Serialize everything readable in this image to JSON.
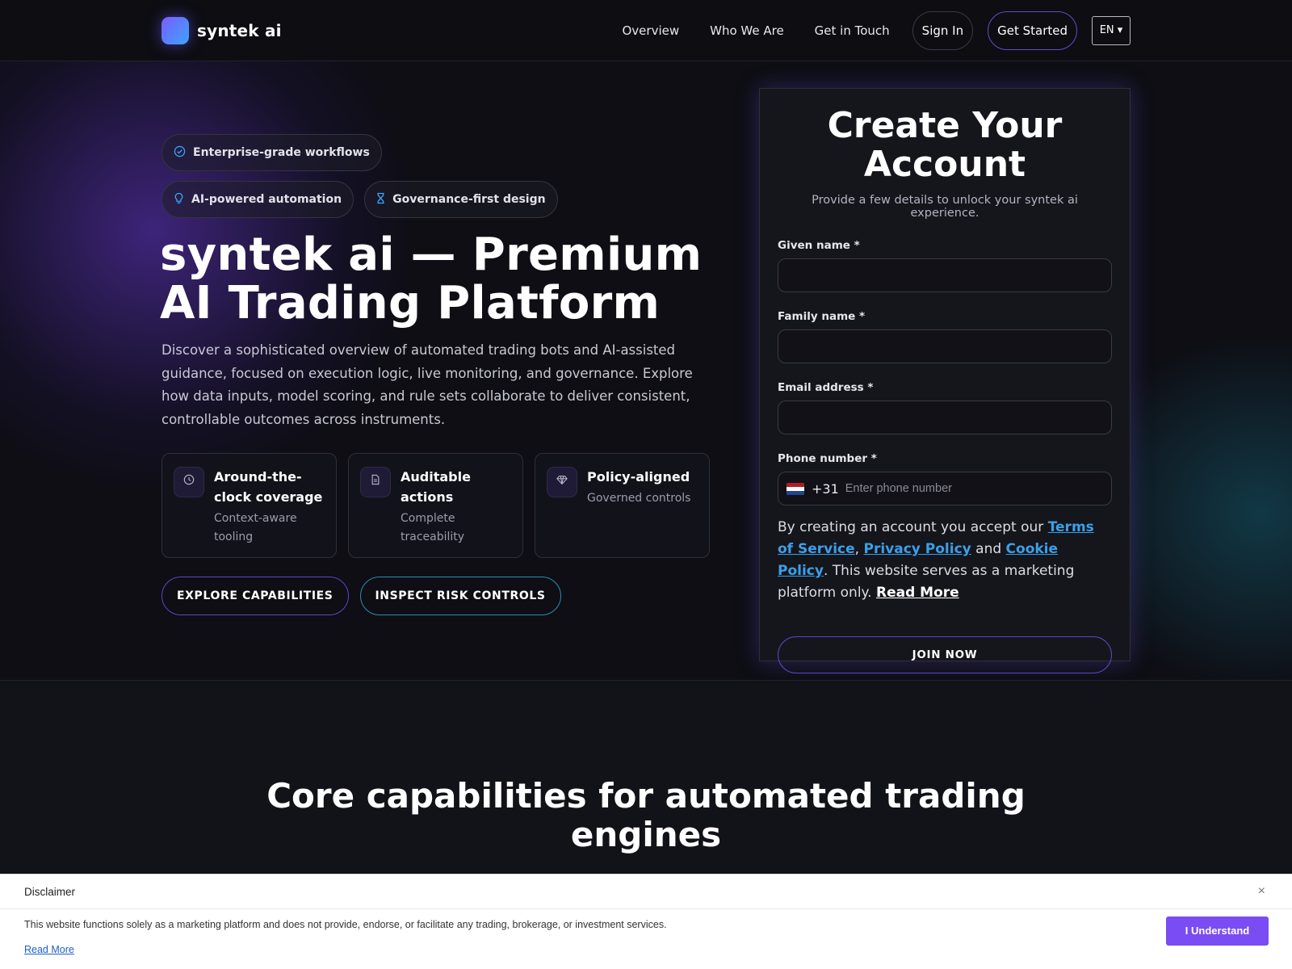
{
  "header": {
    "brand": "syntek ai",
    "nav": [
      "Overview",
      "Who We Are",
      "Get in Touch"
    ],
    "sign_in": "Sign In",
    "get_started": "Get Started",
    "language": "EN ▾"
  },
  "hero": {
    "chips": [
      {
        "icon": "check-circle-icon",
        "label": "Enterprise-grade workflows"
      },
      {
        "icon": "lightbulb-icon",
        "label": "AI-powered automation"
      },
      {
        "icon": "hourglass-icon",
        "label": "Governance-first design"
      }
    ],
    "title": "syntek ai — Premium AI Trading Platform",
    "description": "Discover a sophisticated overview of automated trading bots and AI-assisted guidance, focused on execution logic, live monitoring, and governance. Explore how data inputs, model scoring, and rule sets collaborate to deliver consistent, controllable outcomes across instruments.",
    "features": [
      {
        "icon": "clock-icon",
        "title": "Around-the-clock coverage",
        "subtitle": "Context-aware tooling"
      },
      {
        "icon": "document-icon",
        "title": "Auditable actions",
        "subtitle": "Complete traceability"
      },
      {
        "icon": "diamond-icon",
        "title": "Policy-aligned",
        "subtitle": "Governed controls"
      }
    ],
    "cta_primary": "EXPLORE CAPABILITIES",
    "cta_secondary": "INSPECT RISK CONTROLS"
  },
  "signup": {
    "title": "Create Your Account",
    "subtitle": "Provide a few details to unlock your syntek ai experience.",
    "given_name_label": "Given name *",
    "family_name_label": "Family name *",
    "email_label": "Email address *",
    "phone_label": "Phone number *",
    "dial_code": "+31",
    "phone_placeholder": "Enter phone number",
    "terms_prefix": "By creating an account you accept our ",
    "terms_link": "Terms of Service",
    "comma": ", ",
    "privacy_link": "Privacy Policy",
    "and": " and ",
    "cookie_link": "Cookie Policy",
    "terms_suffix": ". This website serves as a marketing platform only. ",
    "read_more": "Read More",
    "submit": "JOIN NOW"
  },
  "capabilities": {
    "title": "Core capabilities for automated trading engines"
  },
  "disclaimer": {
    "title": "Disclaimer",
    "close": "×",
    "text": "This website functions solely as a marketing platform and does not provide, endorse, or facilitate any trading, brokerage, or investment services.",
    "read_more": "Read More",
    "button": "I Understand"
  },
  "colors": {
    "accent_purple": "#7a4cf3",
    "accent_blue": "#3aa4ff",
    "background": "#0e0e14"
  }
}
